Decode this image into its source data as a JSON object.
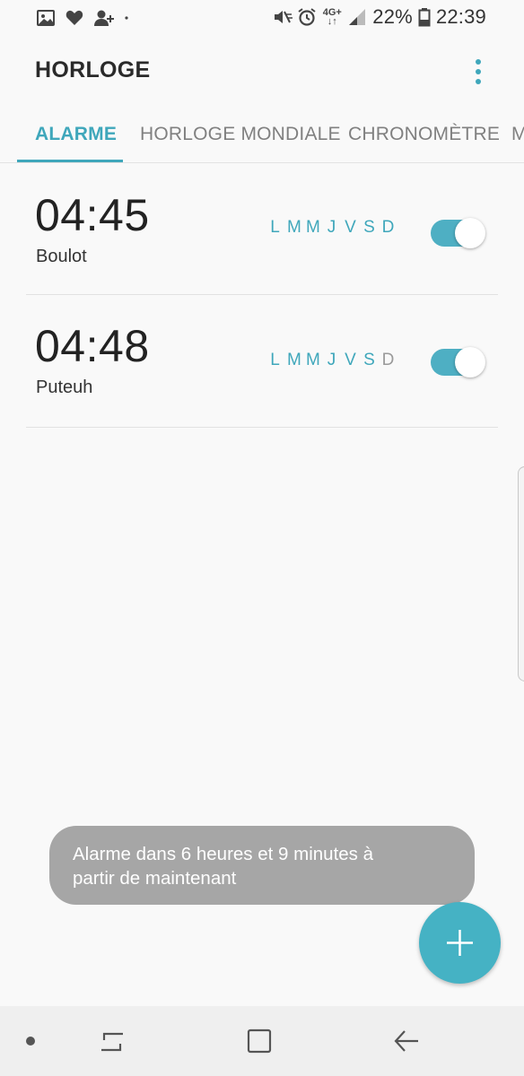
{
  "status_bar": {
    "left_icons": [
      "image-icon",
      "heart-icon",
      "add-contact-icon",
      "dot-icon"
    ],
    "right_icons": [
      "mute-vibrate-icon",
      "alarm-icon",
      "network-4g-icon",
      "signal-icon",
      "battery-icon"
    ],
    "network": "4G+",
    "battery": "22%",
    "time": "22:39"
  },
  "app": {
    "title": "HORLOGE",
    "menu_icon": "more-vertical-icon"
  },
  "tabs": [
    {
      "label": "ALARME",
      "active": true
    },
    {
      "label": "HORLOGE MONDIALE",
      "active": false
    },
    {
      "label": "CHRONOMÈTRE",
      "active": false
    },
    {
      "label": "M",
      "active": false
    }
  ],
  "alarms": [
    {
      "time": "04:45",
      "label": "Boulot",
      "days": [
        {
          "letter": "L",
          "on": true
        },
        {
          "letter": "M",
          "on": true
        },
        {
          "letter": "M",
          "on": true
        },
        {
          "letter": "J",
          "on": true
        },
        {
          "letter": "V",
          "on": true
        },
        {
          "letter": "S",
          "on": true
        },
        {
          "letter": "D",
          "on": true
        }
      ],
      "enabled": true
    },
    {
      "time": "04:48",
      "label": "Puteuh",
      "days": [
        {
          "letter": "L",
          "on": true
        },
        {
          "letter": "M",
          "on": true
        },
        {
          "letter": "M",
          "on": true
        },
        {
          "letter": "J",
          "on": true
        },
        {
          "letter": "V",
          "on": true
        },
        {
          "letter": "S",
          "on": true
        },
        {
          "letter": "D",
          "on": false
        }
      ],
      "enabled": true
    }
  ],
  "toast": {
    "line1": "Alarme dans 6 heures et 9 minutes à",
    "line2": "partir de maintenant"
  },
  "fab": {
    "icon": "plus-icon"
  },
  "nav_bar": {
    "buttons": [
      "dot-icon",
      "recent-apps-icon",
      "home-icon",
      "back-icon"
    ]
  },
  "colors": {
    "accent": "#3fa7bb",
    "toggle_on": "#4eafc3",
    "fab": "#45b2c4",
    "toast_bg": "#a6a6a6",
    "background": "#f9f9f9"
  }
}
